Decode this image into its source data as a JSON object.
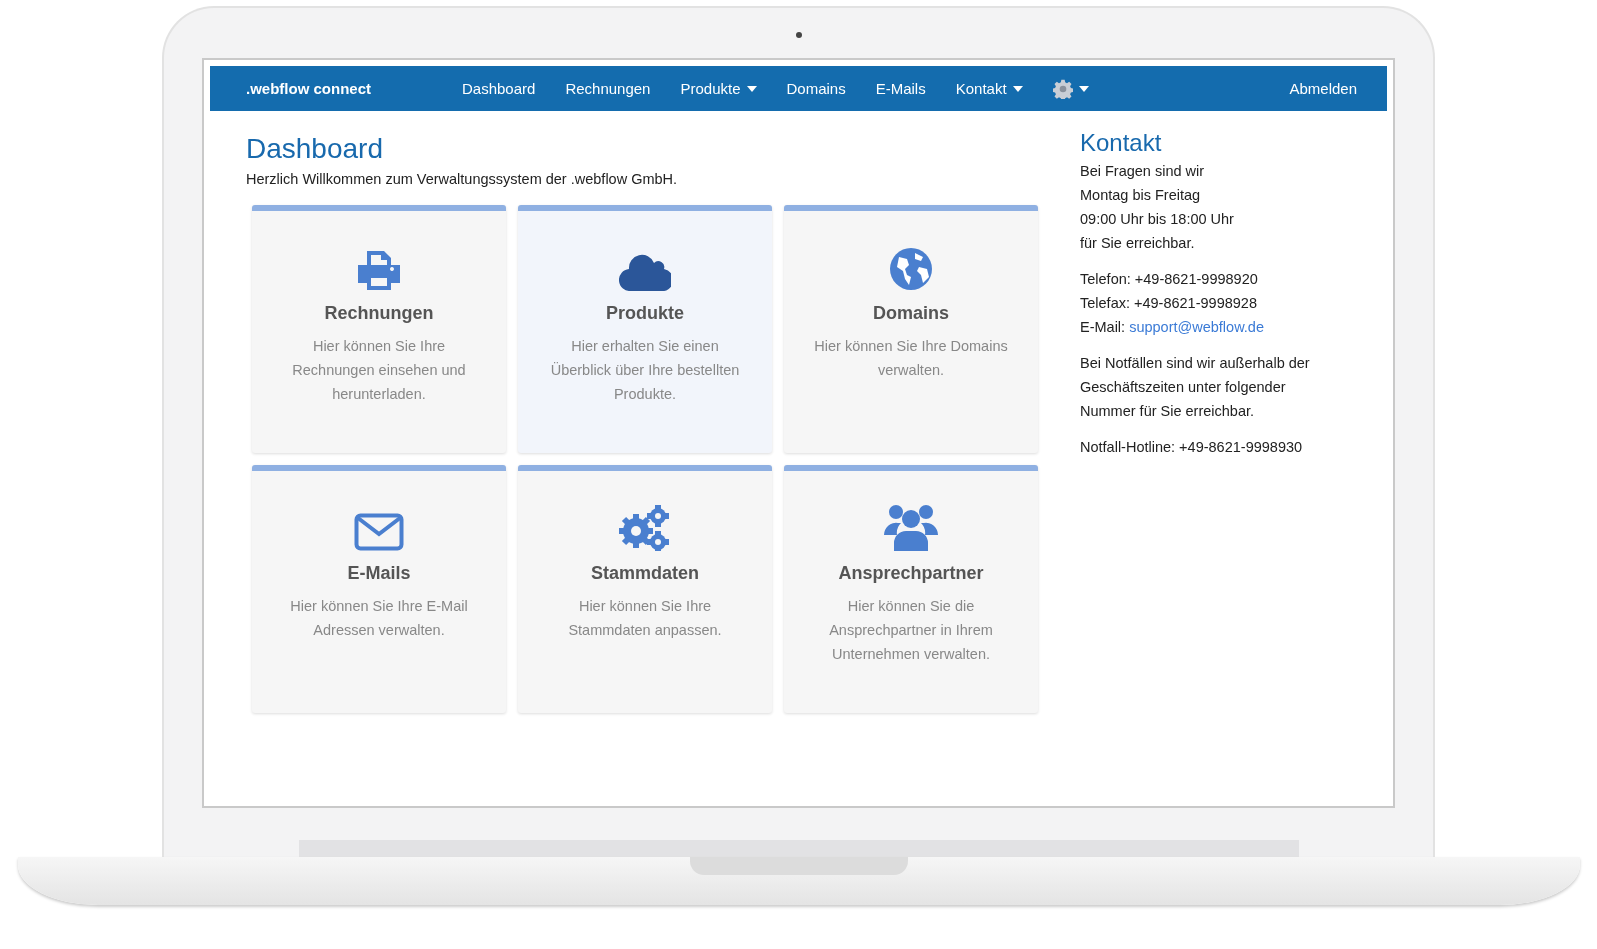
{
  "nav": {
    "brand": ".webflow connect",
    "items": [
      {
        "kind": "link",
        "label": "Dashboard",
        "dropdown": false
      },
      {
        "kind": "link",
        "label": "Rechnungen",
        "dropdown": false
      },
      {
        "kind": "link",
        "label": "Produkte",
        "dropdown": true
      },
      {
        "kind": "link",
        "label": "Domains",
        "dropdown": false
      },
      {
        "kind": "link",
        "label": "E-Mails",
        "dropdown": false
      },
      {
        "kind": "link",
        "label": "Kontakt",
        "dropdown": true
      },
      {
        "kind": "settings",
        "dropdown": true
      }
    ],
    "logout": "Abmelden"
  },
  "page": {
    "title": "Dashboard",
    "intro": "Herzlich Willkommen zum Verwaltungssystem der .webflow GmbH."
  },
  "tiles": [
    {
      "kind": "printer",
      "title": "Rechnungen",
      "text": "Hier können Sie Ihre Rechnungen einsehen und herunterladen.",
      "highlighted": false
    },
    {
      "kind": "cloud",
      "title": "Produkte",
      "text": "Hier erhalten Sie einen Überblick über Ihre bestellten Produkte.",
      "highlighted": true
    },
    {
      "kind": "globe",
      "title": "Domains",
      "text": "Hier können Sie Ihre Domains verwalten.",
      "highlighted": false
    },
    {
      "kind": "envelope",
      "title": "E-Mails",
      "text": "Hier können Sie Ihre E-Mail Adressen verwalten.",
      "highlighted": false
    },
    {
      "kind": "gears",
      "title": "Stammdaten",
      "text": "Hier können Sie Ihre Stammdaten anpassen.",
      "highlighted": false
    },
    {
      "kind": "users",
      "title": "Ansprechpartner",
      "text": "Hier können Sie die Ansprechpartner in Ihrem Unternehmen verwalten.",
      "highlighted": false
    }
  ],
  "contact": {
    "title": "Kontakt",
    "paragraphs": [
      {
        "lines": [
          {
            "text": "Bei Fragen sind wir"
          },
          {
            "text": "Montag bis Freitag"
          },
          {
            "text": "09:00 Uhr bis 18:00 Uhr"
          },
          {
            "text": "für Sie erreichbar."
          }
        ]
      },
      {
        "lines": [
          {
            "text": "Telefon: +49-8621-9998920"
          },
          {
            "text": "Telefax: +49-8621-9998928"
          },
          {
            "text": "E-Mail:",
            "link": "support@webflow.de"
          }
        ]
      },
      {
        "lines": [
          {
            "text": "Bei Notfällen sind wir außerhalb der Geschäftszeiten unter folgender Nummer für Sie erreichbar."
          }
        ]
      },
      {
        "lines": [
          {
            "text": "Notfall-Hotline: +49-8621-9998930"
          }
        ]
      }
    ]
  }
}
